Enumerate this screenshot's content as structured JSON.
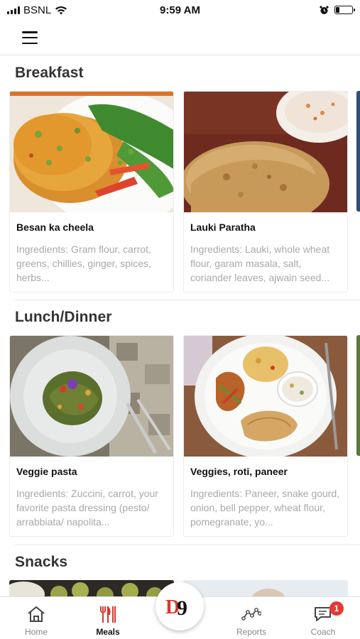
{
  "status_bar": {
    "carrier": "BSNL",
    "time": "9:59 AM"
  },
  "sections": [
    {
      "title": "Breakfast",
      "cards": [
        {
          "title": "Besan ka cheela",
          "description": "Ingredients: Gram flour, carrot, greens, chillies, ginger, spices, herbs..."
        },
        {
          "title": "Lauki Paratha",
          "description": "Ingredients: Lauki, whole wheat flour, garam masala, salt, coriander leaves, ajwain seed..."
        }
      ]
    },
    {
      "title": "Lunch/Dinner",
      "cards": [
        {
          "title": "Veggie pasta",
          "description": "Ingredients: Zuccini, carrot, your favorite pasta dressing (pesto/ arrabbiata/ napolita..."
        },
        {
          "title": "Veggies, roti, paneer",
          "description": "Ingredients: Paneer, snake gourd, onion, bell pepper, wheat flour, pomegranate, yo..."
        }
      ]
    },
    {
      "title": "Snacks"
    }
  ],
  "tab_bar": {
    "home": "Home",
    "meals": "Meals",
    "center_logo": "D9",
    "reports": "Reports",
    "coach": "Coach",
    "coach_badge": "1"
  },
  "colors": {
    "accent": "#d43a2b",
    "badge": "#e53935"
  }
}
